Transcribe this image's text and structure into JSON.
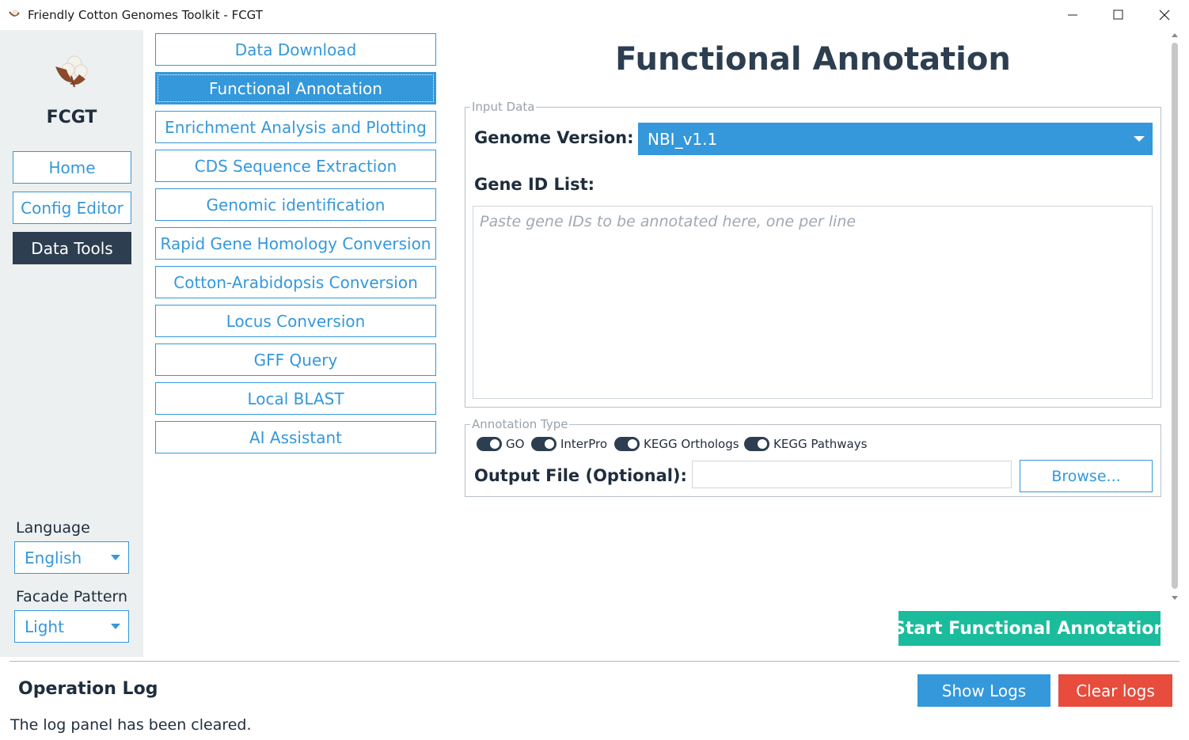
{
  "window": {
    "title": "Friendly Cotton Genomes Toolkit - FCGT",
    "controls": [
      "minimize-icon",
      "maximize-icon",
      "close-icon"
    ]
  },
  "sidebar": {
    "brand": "FCGT",
    "nav": [
      {
        "label": "Home",
        "active": false
      },
      {
        "label": "Config Editor",
        "active": false
      },
      {
        "label": "Data Tools",
        "active": true
      }
    ],
    "language": {
      "label": "Language",
      "value": "English"
    },
    "facade": {
      "label": "Facade Pattern",
      "value": "Light"
    }
  },
  "tools": [
    {
      "label": "Data Download",
      "active": false
    },
    {
      "label": "Functional Annotation",
      "active": true
    },
    {
      "label": "Enrichment Analysis and Plotting",
      "active": false
    },
    {
      "label": "CDS Sequence Extraction",
      "active": false
    },
    {
      "label": "Genomic identification",
      "active": false
    },
    {
      "label": "Rapid Gene Homology Conversion",
      "active": false
    },
    {
      "label": "Cotton-Arabidopsis Conversion",
      "active": false
    },
    {
      "label": "Locus Conversion",
      "active": false
    },
    {
      "label": "GFF Query",
      "active": false
    },
    {
      "label": "Local BLAST",
      "active": false
    },
    {
      "label": "AI Assistant",
      "active": false
    }
  ],
  "main": {
    "title": "Functional Annotation",
    "input_group": "Input Data",
    "genome_label": "Genome Version:",
    "genome_value": "NBI_v1.1",
    "gene_list_label": "Gene ID List:",
    "gene_list_placeholder": "Paste gene IDs to be annotated here, one per line",
    "gene_list_value": "",
    "annotation_group": "Annotation Type",
    "annotation_types": [
      {
        "label": "GO",
        "checked": true
      },
      {
        "label": "InterPro",
        "checked": true
      },
      {
        "label": "KEGG Orthologs",
        "checked": true
      },
      {
        "label": "KEGG Pathways",
        "checked": true
      }
    ],
    "output_label": "Output File (Optional):",
    "output_value": "",
    "browse_label": "Browse...",
    "start_label": "Start Functional Annotation"
  },
  "log": {
    "title": "Operation Log",
    "show_label": "Show Logs",
    "clear_label": "Clear logs",
    "message": "The log panel has been cleared."
  },
  "colors": {
    "accent": "#3498db",
    "dark": "#2c3e50",
    "success": "#1abc9c",
    "danger": "#e74c3c",
    "sidebar_bg": "#ecf0f1"
  }
}
